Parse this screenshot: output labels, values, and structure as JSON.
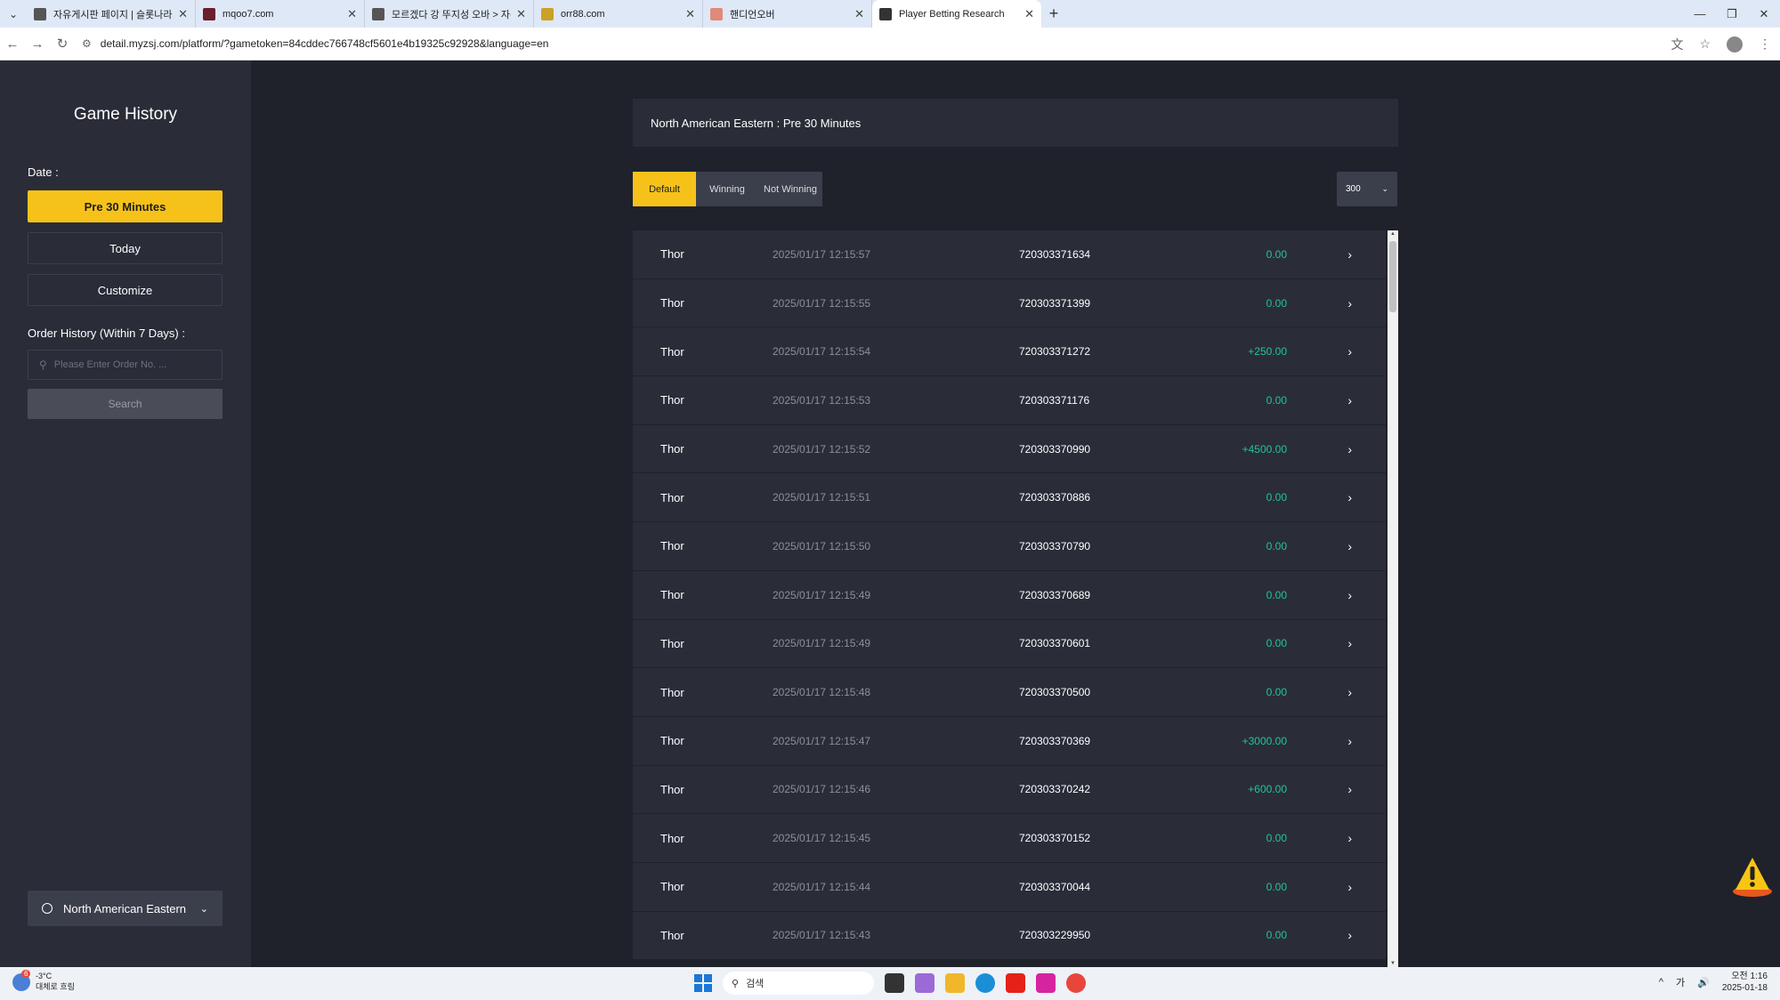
{
  "browser": {
    "tabs": [
      {
        "title": "자유게시판 페이지 | 슬롯나라",
        "favicon_color": "#555555",
        "active": false
      },
      {
        "title": "mqoo7.com",
        "favicon_color": "#6b1e2e",
        "active": false
      },
      {
        "title": "모르겠다 강 뚜지성 오바 > 자유",
        "favicon_color": "#555555",
        "active": false
      },
      {
        "title": "orr88.com",
        "favicon_color": "#c9a227",
        "active": false
      },
      {
        "title": "핸디언오버",
        "favicon_color": "#e08a7a",
        "active": false
      },
      {
        "title": "Player Betting Research",
        "favicon_color": "#333333",
        "active": true
      }
    ],
    "url": "detail.myzsj.com/platform/?gametoken=84cddec766748cf5601e4b19325c92928&language=en"
  },
  "sidebar": {
    "title": "Game History",
    "date_label": "Date :",
    "date_buttons": [
      "Pre 30 Minutes",
      "Today",
      "Customize"
    ],
    "order_label": "Order History (Within 7 Days) :",
    "order_placeholder": "Please Enter Order No. ...",
    "search_label": "Search",
    "timezone": "North American Eastern"
  },
  "main": {
    "header": "North American Eastern : Pre 30 Minutes",
    "filters": [
      "Default",
      "Winning",
      "Not Winning"
    ],
    "page_size": "300",
    "rows": [
      {
        "game": "Thor",
        "time": "2025/01/17 12:15:57",
        "order": "720303371634",
        "amount": "0.00"
      },
      {
        "game": "Thor",
        "time": "2025/01/17 12:15:55",
        "order": "720303371399",
        "amount": "0.00"
      },
      {
        "game": "Thor",
        "time": "2025/01/17 12:15:54",
        "order": "720303371272",
        "amount": "+250.00"
      },
      {
        "game": "Thor",
        "time": "2025/01/17 12:15:53",
        "order": "720303371176",
        "amount": "0.00"
      },
      {
        "game": "Thor",
        "time": "2025/01/17 12:15:52",
        "order": "720303370990",
        "amount": "+4500.00"
      },
      {
        "game": "Thor",
        "time": "2025/01/17 12:15:51",
        "order": "720303370886",
        "amount": "0.00"
      },
      {
        "game": "Thor",
        "time": "2025/01/17 12:15:50",
        "order": "720303370790",
        "amount": "0.00"
      },
      {
        "game": "Thor",
        "time": "2025/01/17 12:15:49",
        "order": "720303370689",
        "amount": "0.00"
      },
      {
        "game": "Thor",
        "time": "2025/01/17 12:15:49",
        "order": "720303370601",
        "amount": "0.00"
      },
      {
        "game": "Thor",
        "time": "2025/01/17 12:15:48",
        "order": "720303370500",
        "amount": "0.00"
      },
      {
        "game": "Thor",
        "time": "2025/01/17 12:15:47",
        "order": "720303370369",
        "amount": "+3000.00"
      },
      {
        "game": "Thor",
        "time": "2025/01/17 12:15:46",
        "order": "720303370242",
        "amount": "+600.00"
      },
      {
        "game": "Thor",
        "time": "2025/01/17 12:15:45",
        "order": "720303370152",
        "amount": "0.00"
      },
      {
        "game": "Thor",
        "time": "2025/01/17 12:15:44",
        "order": "720303370044",
        "amount": "0.00"
      },
      {
        "game": "Thor",
        "time": "2025/01/17 12:15:43",
        "order": "720303229950",
        "amount": "0.00"
      }
    ]
  },
  "taskbar": {
    "weather_temp": "-3°C",
    "weather_desc": "대체로 흐림",
    "weather_badge": "6",
    "search_text": "검색",
    "ime": "가",
    "time": "오전 1:16",
    "date": "2025-01-18"
  },
  "colors": {
    "accent": "#f6c21a",
    "win_amount": "#22c39a",
    "panel": "#2a2d38",
    "background": "#1f222b"
  }
}
